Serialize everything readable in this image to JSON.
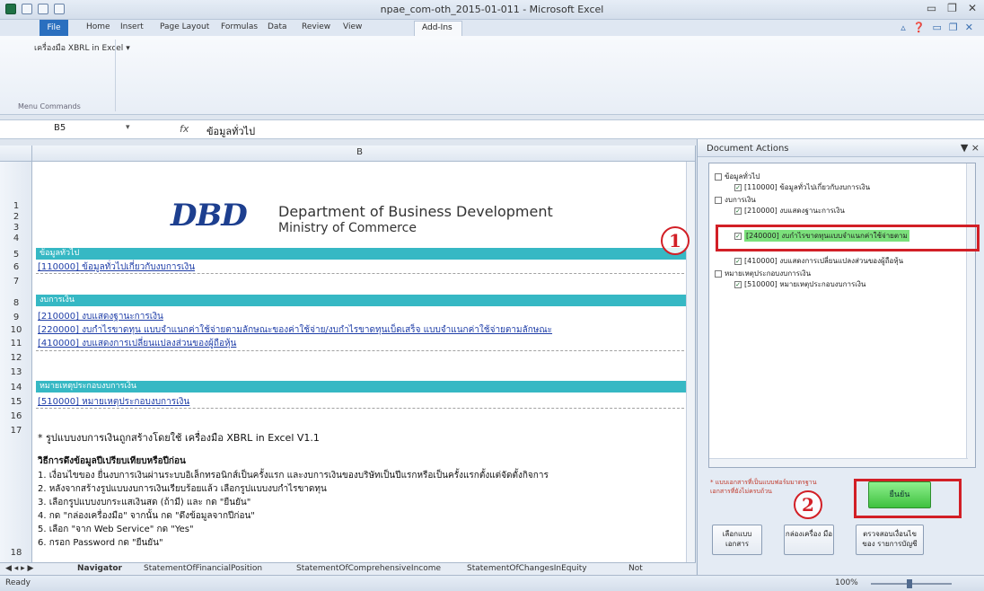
{
  "window": {
    "title": "npae_com-oth_2015-01-011 - Microsoft Excel"
  },
  "ribbon": {
    "tabs": [
      {
        "label": "File"
      },
      {
        "label": "Home"
      },
      {
        "label": "Insert"
      },
      {
        "label": "Page Layout"
      },
      {
        "label": "Formulas"
      },
      {
        "label": "Data"
      },
      {
        "label": "Review"
      },
      {
        "label": "View"
      },
      {
        "label": "Add-Ins"
      }
    ],
    "addin_button": "เครื่องมือ XBRL in Excel",
    "group_label": "Menu Commands"
  },
  "formula_bar": {
    "name_box": "B5",
    "fx": "fx",
    "value": "ข้อมูลทั่วไป"
  },
  "sheet": {
    "column_header": "B",
    "row_numbers": [
      "1",
      "2",
      "3",
      "4",
      "5",
      "6",
      "7",
      "8",
      "9",
      "10",
      "11",
      "12",
      "13",
      "14",
      "15",
      "16",
      "17",
      "18"
    ],
    "logo": {
      "mark_dbd": "DBD",
      "dept": "Department of Business Development",
      "ministry": "Ministry of Commerce"
    },
    "bands": {
      "general": "ข้อมูลทั่วไป",
      "financial": "งบการเงิน",
      "notes": "หมายเหตุประกอบงบการเงิน"
    },
    "links": {
      "r6": "[110000] ข้อมูลทั่วไปเกี่ยวกับงบการเงิน",
      "r9": "[210000] งบแสดงฐานะการเงิน",
      "r10": "[220000] งบกำไรขาดทุน  แบบจำแนกค่าใช้จ่ายตามลักษณะของค่าใช้จ่าย/งบกำไรขาดทุนเบ็ดเสร็จ  แบบจำแนกค่าใช้จ่ายตามลักษณะ",
      "r11": "[410000] งบแสดงการเปลี่ยนแปลงส่วนของผู้ถือหุ้น",
      "r14": "[510000] หมายเหตุประกอบงบการเงิน"
    },
    "r16_note": "* รูปแบบงบการเงินถูกสร้างโดยใช้ เครื่องมือ XBRL in Excel V1.1",
    "instructions": {
      "heading": "วิธีการดึงข้อมูลปีเปรียบเทียบหรือปีก่อน",
      "steps": [
        "1. เงื่อนไขของ ยื่นงบการเงินผ่านระบบอิเล็กทรอนิกส์เป็นครั้งแรก และงบการเงินของบริษัทเป็นปีแรกหรือเป็นครั้งแรกตั้งแต่จัดตั้งกิจการ",
        "2. หลังจากสร้างรูปแบบงบการเงินเรียบร้อยแล้ว เลือกรูปแบบงบกำไรขาดทุน",
        "3. เลือกรูปแบบงบกระแสเงินสด (ถ้ามี) และ กด \"ยืนยัน\"",
        "4. กด \"กล่องเครื่องมือ\" จากนั้น กด \"ดึงข้อมูลจากปีก่อน\"",
        "5. เลือก \"จาก Web Service\" กด \"Yes\"",
        "6. กรอก Password กด \"ยืนยัน\""
      ]
    },
    "sheet_tabs": [
      "Navigator",
      "StatementOfFinancialPosition",
      "StatementOfComprehensiveIncome",
      "StatementOfChangesInEquity",
      "Not"
    ]
  },
  "pane": {
    "title": "Document Actions",
    "close": "▼ ×",
    "tree": [
      {
        "label": "ข้อมูลทั่วไป",
        "checked": false
      },
      {
        "label": "[110000] ข้อมูลทั่วไปเกี่ยวกับงบการเงิน",
        "checked": true
      },
      {
        "label": "งบการเงิน",
        "checked": false
      },
      {
        "label": "[210000] งบแสดงฐานะการเงิน",
        "checked": true
      },
      {
        "label": "[240000] งบกำไรขาดทุนแบบจำแนกค่าใช้จ่ายตาม",
        "checked": true,
        "highlight": true
      },
      {
        "label": "[410000] งบแสดงการเปลี่ยนแปลงส่วนของผู้ถือหุ้น",
        "checked": true
      },
      {
        "label": "หมายเหตุประกอบงบการเงิน",
        "checked": false
      },
      {
        "label": "[510000] หมายเหตุประกอบงบการเงิน",
        "checked": true
      }
    ],
    "note": "* แบบเอกสารที่เป็นแบบฟอร์มมาตรฐาน เอกสารที่ยังไม่ครบถ้วน",
    "confirm_button": "ยืนยัน",
    "buttons": [
      {
        "label": "เลือกแบบ เอกสาร"
      },
      {
        "label": "กล่องเครื่อง มือ"
      },
      {
        "label": "ตรวจสอบเงื่อนไขของ รายการบัญชี"
      }
    ]
  },
  "annotations": {
    "step1": "1",
    "step2": "2"
  },
  "status": {
    "ready": "Ready",
    "zoom": "100%"
  },
  "colors": {
    "band": "#36b8c4",
    "highlight": "#7be07b",
    "annotation_red": "#d21f26",
    "confirm_green": "#4cc84c"
  }
}
